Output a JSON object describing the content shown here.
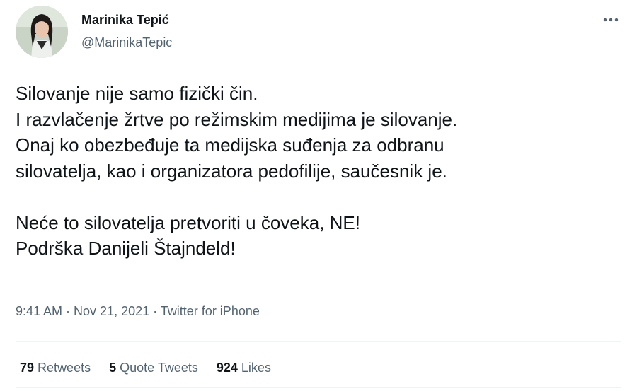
{
  "author": {
    "name": "Marinika Tepić",
    "handle": "@MarinikaTepic"
  },
  "more_icon": "more-horizontal-icon",
  "tweet": {
    "lines": [
      "Silovanje nije samo fizički čin.",
      "I razvlačenje žrtve po režimskim medijima je silovanje.",
      "Onaj ko obezbeđuje ta medijska suđenja za odbranu",
      "silovatelja, kao i organizatora pedofilije, saučesnik je.",
      "",
      "Neće to silovatelja pretvoriti u čoveka, NE!",
      "Podrška Danijeli Štajndeld!"
    ]
  },
  "meta": {
    "time": "9:41 AM",
    "separator": " · ",
    "date": "Nov 21, 2021",
    "source": "Twitter for iPhone"
  },
  "stats": {
    "retweets_count": "79",
    "retweets_label": "Retweets",
    "quote_count": "5",
    "quote_label": "Quote Tweets",
    "likes_count": "924",
    "likes_label": "Likes"
  },
  "colors": {
    "text": "#0f1419",
    "secondary": "#536471",
    "divider": "#eff3f4"
  }
}
